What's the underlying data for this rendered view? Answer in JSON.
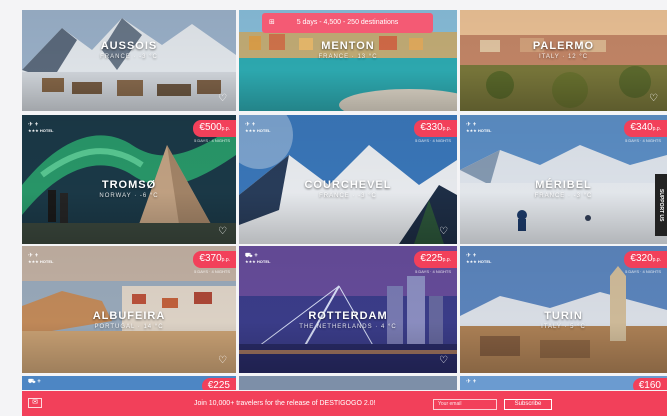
{
  "promo_banner": {
    "text": "5 days - 4,500 - 250 destinations",
    "icon": "calendar-icon"
  },
  "support_tab": {
    "label": "SUPPORT US"
  },
  "transport_labels": {
    "star_text": "★★★",
    "hotel_text": "HOTEL",
    "flight_icon": "plane-icon",
    "car_icon": "car-icon"
  },
  "cards": [
    {
      "city": "AUSSOIS",
      "sub": "FRANCE · -3 °C",
      "price": "",
      "info": ""
    },
    {
      "city": "MENTON",
      "sub": "FRANCE · 13 °C",
      "price": "",
      "info": ""
    },
    {
      "city": "PALERMO",
      "sub": "ITALY · 12 °C",
      "price": "",
      "info": ""
    },
    {
      "city": "TROMSØ",
      "sub": "NORWAY · -6 °C",
      "price": "€500",
      "unit": "p.p.",
      "info": "5 DAYS · 4 NIGHTS"
    },
    {
      "city": "COURCHEVEL",
      "sub": "FRANCE · -3 °C",
      "price": "€330",
      "unit": "p.p.",
      "info": "5 DAYS · 4 NIGHTS"
    },
    {
      "city": "MÉRIBEL",
      "sub": "FRANCE · -3 °C",
      "price": "€340",
      "unit": "p.p.",
      "info": "5 DAYS · 4 NIGHTS"
    },
    {
      "city": "ALBUFEIRA",
      "sub": "PORTUGAL · 14 °C",
      "price": "€370",
      "unit": "p.p.",
      "info": "5 DAYS · 4 NIGHTS"
    },
    {
      "city": "ROTTERDAM",
      "sub": "THE NETHERLANDS · 4 °C",
      "price": "€225",
      "unit": "p.p.",
      "info": "5 DAYS · 4 NIGHTS"
    },
    {
      "city": "TURIN",
      "sub": "ITALY · 5 °C",
      "price": "€320",
      "unit": "p.p.",
      "info": "5 DAYS · 4 NIGHTS"
    },
    {
      "city": "",
      "sub": "",
      "price": "€225",
      "unit": "",
      "info": ""
    },
    {
      "city": "",
      "sub": "",
      "price": "",
      "unit": "",
      "info": ""
    },
    {
      "city": "",
      "sub": "",
      "price": "€160",
      "unit": "",
      "info": ""
    }
  ],
  "footer": {
    "message": "Join 10,000+ travelers for the release of DESTIGOGO 2.0!",
    "email_placeholder": "Your email",
    "subscribe_label": "Subscribe"
  },
  "colors": {
    "accent": "#f2405a",
    "banner": "#f45a74",
    "background": "#f4f4f6"
  }
}
